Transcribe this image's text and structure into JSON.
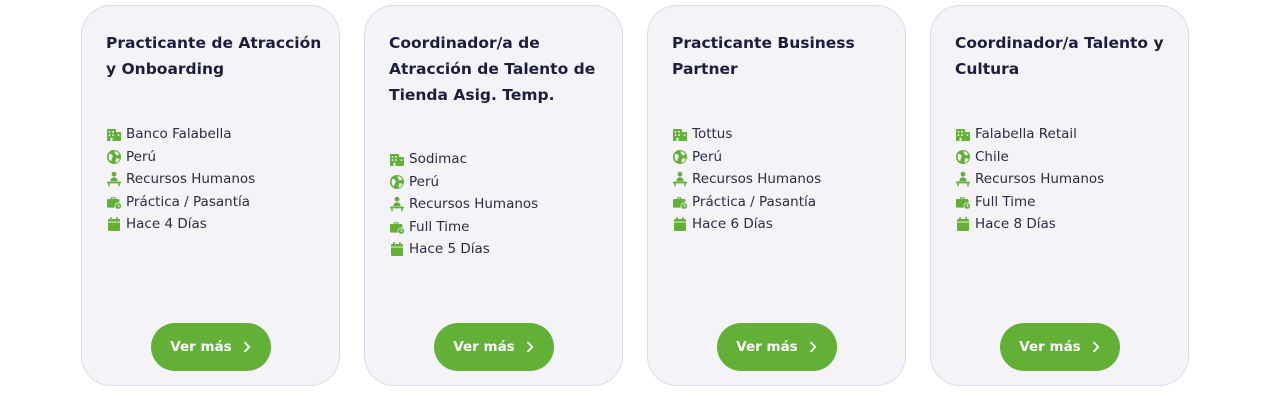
{
  "colors": {
    "accent": "#62b035",
    "card_bg": "#f3f3f8",
    "card_border": "#dcdce6",
    "title": "#1c1d3f",
    "text": "#2b2c45"
  },
  "cards": [
    {
      "title": "Practicante de Atracción y Onboarding",
      "company": "Banco Falabella",
      "country": "Perú",
      "area": "Recursos Humanos",
      "type": "Práctica / Pasantía",
      "posted": "Hace 4 Días",
      "button": "Ver más"
    },
    {
      "title": "Coordinador/a de Atracción de Talento de Tienda Asig. Temp.",
      "company": "Sodimac",
      "country": "Perú",
      "area": "Recursos Humanos",
      "type": "Full Time",
      "posted": "Hace 5 Días",
      "button": "Ver más"
    },
    {
      "title": "Practicante Business Partner",
      "company": "Tottus",
      "country": "Perú",
      "area": "Recursos Humanos",
      "type": "Práctica / Pasantía",
      "posted": "Hace 6 Días",
      "button": "Ver más"
    },
    {
      "title": "Coordinador/a Talento y Cultura",
      "company": "Falabella Retail",
      "country": "Chile",
      "area": "Recursos Humanos",
      "type": "Full Time",
      "posted": "Hace 8 Días",
      "button": "Ver más"
    }
  ],
  "icons": {
    "company": "building-icon",
    "country": "globe-icon",
    "area": "person-desk-icon",
    "type": "briefcase-clock-icon",
    "posted": "calendar-icon",
    "button": "chevron-right-icon"
  }
}
